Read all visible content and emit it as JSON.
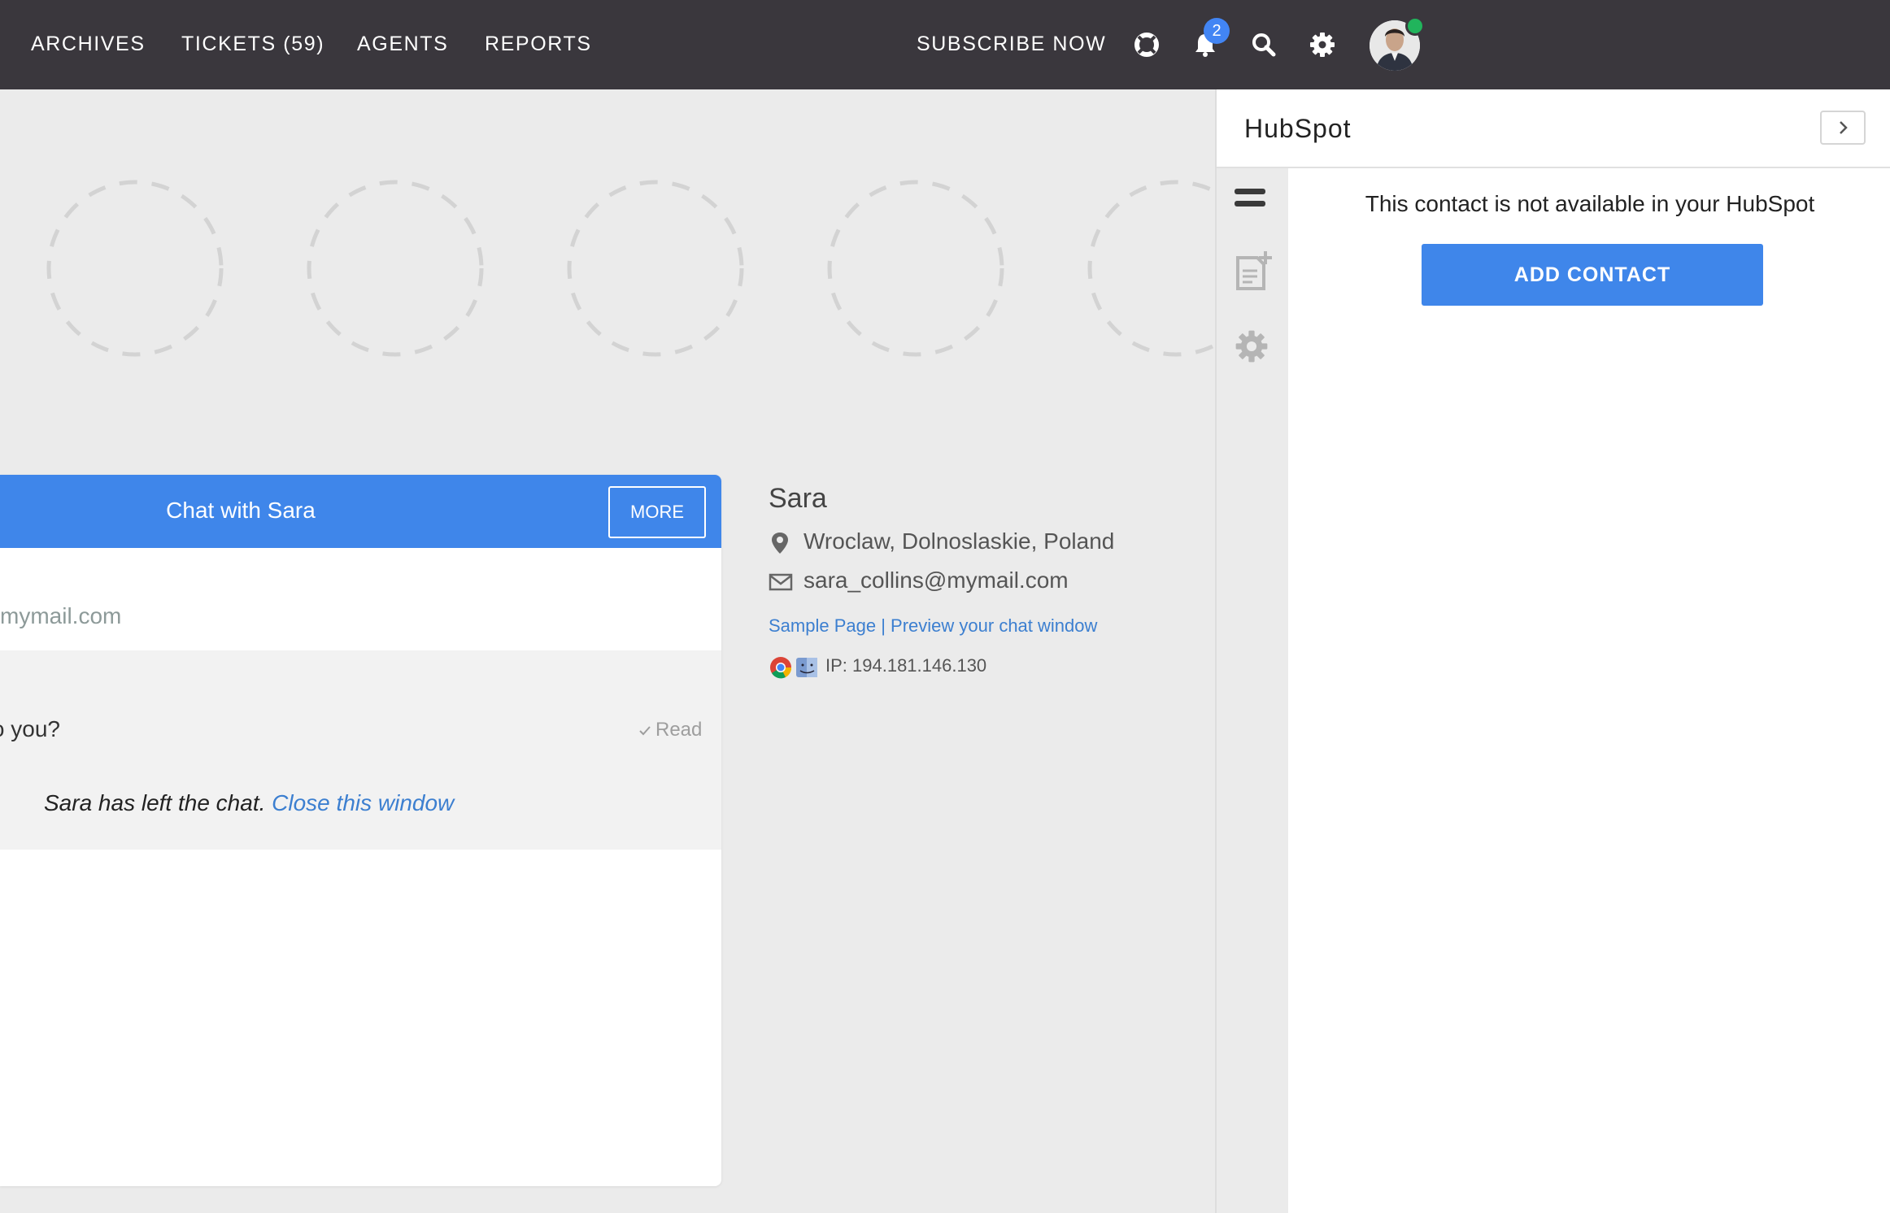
{
  "topbar": {
    "nav": [
      "ARCHIVES",
      "TICKETS (59)",
      "AGENTS",
      "REPORTS"
    ],
    "subscribe_label": "SUBSCRIBE NOW",
    "icons": [
      "lifebuoy-icon",
      "bell-icon",
      "search-icon",
      "gear-icon"
    ],
    "notification_count": "2",
    "online_status_color": "#21b45c"
  },
  "chat": {
    "title": "Chat with Sara",
    "more_label": "MORE",
    "email_fragment": "mymail.com",
    "message_fragment": "o you?",
    "read_label": "Read",
    "left_text": "Sara has left the chat.",
    "close_link": "Close this window",
    "accent": "#3f86ea"
  },
  "visitor": {
    "name": "Sara",
    "location": "Wroclaw, Dolnoslaskie, Poland",
    "email": "sara_collins@mymail.com",
    "link_sample": "Sample Page",
    "link_separator": " | ",
    "link_preview": "Preview your chat window",
    "ip": "IP: 194.181.146.130",
    "browser_icons": [
      "chrome-icon",
      "macos-finder-icon"
    ]
  },
  "hubspot": {
    "title": "HubSpot",
    "message": "This contact is not available in your HubSpot",
    "add_label": "ADD CONTACT",
    "side_icons": [
      "menu-icon",
      "add-note-icon",
      "settings-gear-icon"
    ]
  }
}
